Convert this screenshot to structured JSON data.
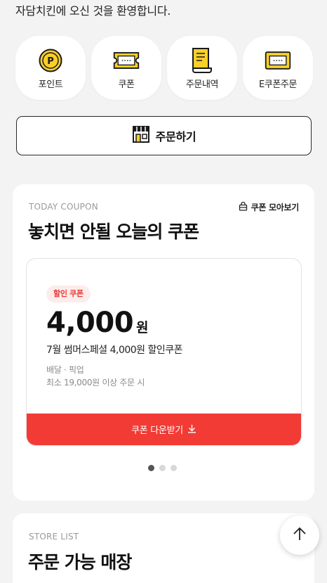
{
  "header": {
    "welcome": "자담치킨에 오신 것을 환영합니다."
  },
  "quick_menu": [
    {
      "label": "포인트",
      "icon": "point-coin-icon"
    },
    {
      "label": "쿠폰",
      "icon": "ticket-icon"
    },
    {
      "label": "주문내역",
      "icon": "receipt-icon"
    },
    {
      "label": "E쿠폰주문",
      "icon": "ecoupon-card-icon"
    }
  ],
  "order_button": {
    "label": "주문하기",
    "icon": "store-icon"
  },
  "coupon_section": {
    "eyebrow": "TODAY COUPON",
    "title": "놓치면 안될 오늘의 쿠폰",
    "more_label": "쿠폰 모아보기",
    "coupon": {
      "tag": "할인 쿠폰",
      "amount": "4,000",
      "unit": "원",
      "name": "7월 썸머스페셜 4,000원 할인쿠폰",
      "method": "배달 · 픽업",
      "min_order": "최소 19,000원 이상 주문 시",
      "download_label": "쿠폰 다운받기"
    },
    "pagination": {
      "total": 3,
      "current": 1
    }
  },
  "store_section": {
    "eyebrow": "STORE LIST",
    "title": "주문 가능 매장"
  },
  "colors": {
    "accent_yellow": "#f9cf2a",
    "accent_red": "#f23b35",
    "tag_bg": "#fdeceb",
    "background": "#f3f3f3"
  }
}
